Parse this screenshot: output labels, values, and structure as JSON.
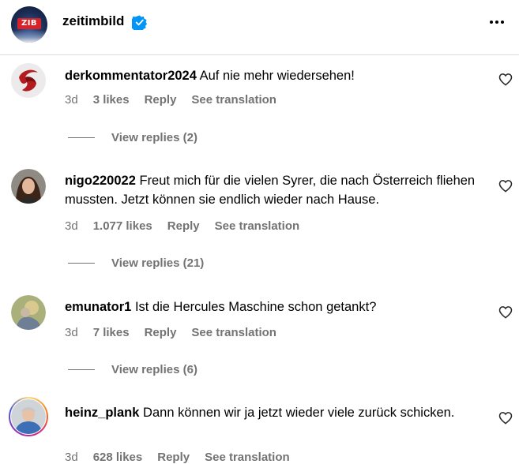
{
  "post": {
    "username": "zeitimbild",
    "logo_text": "ZIB",
    "verified_icon": "verified-badge-icon",
    "more_icon": "more-options-icon"
  },
  "colors": {
    "verified_blue": "#0095f6",
    "meta_gray": "#737373",
    "divider": "#dbdbdb"
  },
  "comments": [
    {
      "username": "derkommentator2024",
      "text": "Auf nie mehr wiedersehen!",
      "time": "3d",
      "likes": "3 likes",
      "reply_label": "Reply",
      "translate_label": "See translation",
      "view_replies": "View replies (2)"
    },
    {
      "username": "nigo220022",
      "text": "Freut mich für die vielen Syrer, die nach Österreich fliehen mussten. Jetzt können sie endlich wieder nach Hause.",
      "time": "3d",
      "likes": "1.077 likes",
      "reply_label": "Reply",
      "translate_label": "See translation",
      "view_replies": "View replies (21)"
    },
    {
      "username": "emunator1",
      "text": "Ist die Hercules Maschine schon getankt?",
      "time": "3d",
      "likes": "7 likes",
      "reply_label": "Reply",
      "translate_label": "See translation",
      "view_replies": "View replies (6)"
    },
    {
      "username": "heinz_plank",
      "text": "Dann können wir ja jetzt wieder viele zurück schicken.",
      "time": "3d",
      "likes": "628 likes",
      "reply_label": "Reply",
      "translate_label": "See translation"
    }
  ]
}
